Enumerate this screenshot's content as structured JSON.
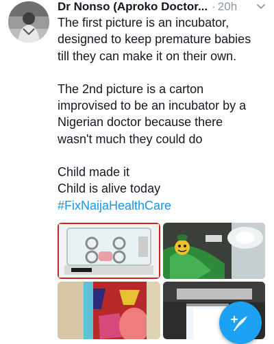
{
  "tweet": {
    "author_name": "Dr Nonso (Aproko Doctor...",
    "separator": "·",
    "timestamp": "20h",
    "paragraphs": [
      [
        "The first picture is an incubator,",
        "designed to keep premature babies",
        "till they can make it on their own."
      ],
      [
        "The 2nd picture is a carton",
        "improvised to be an incubator by a",
        "Nigerian doctor because there",
        "wasn't much they could do"
      ],
      [
        "Child made it",
        "Child is alive today"
      ]
    ],
    "hashtag": "#FixNaijaHealthCare"
  },
  "media": [
    {
      "name": "incubator-photo"
    },
    {
      "name": "carton-incubator-photo"
    },
    {
      "name": "baby-blanket-photo"
    },
    {
      "name": "lamp-photo"
    }
  ],
  "icons": {
    "menu": "chevron-down-icon",
    "compose": "compose-tweet-icon"
  },
  "colors": {
    "link": "#1b95e0",
    "secondary_text": "#8899a6",
    "fab": "#1da1f2"
  }
}
